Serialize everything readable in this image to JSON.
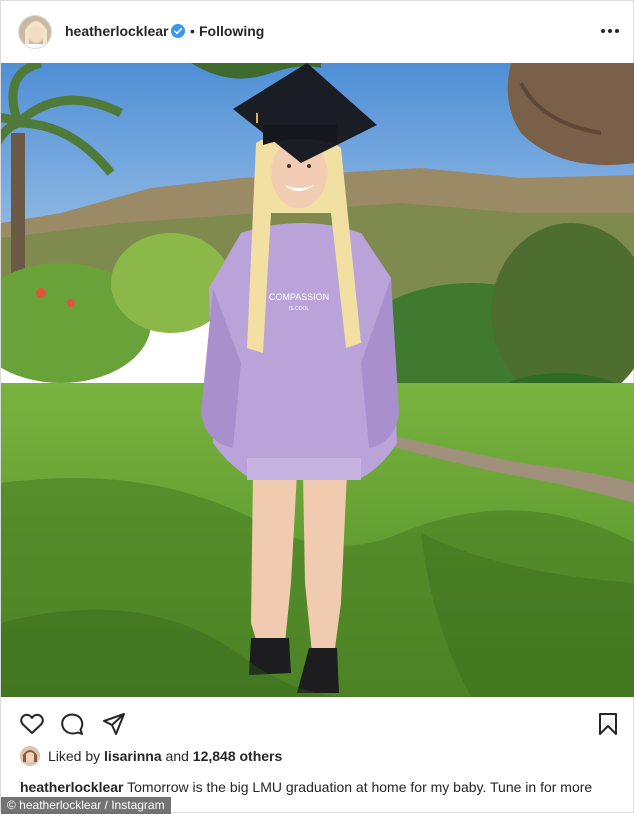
{
  "header": {
    "username": "heatherlocklear",
    "separator": "•",
    "follow_state": "Following",
    "icons": {
      "verified": "verified-badge-icon",
      "more": "more-options-icon"
    }
  },
  "photo": {
    "alt": "Graduate in a lavender sweatshirt and black mortarboard standing on a lawn",
    "sweatshirt_text": "COMPASSION",
    "sweatshirt_subtext": "IS COOL"
  },
  "actions": {
    "icons": [
      "heart-icon",
      "comment-icon",
      "share-icon",
      "bookmark-icon"
    ]
  },
  "likes": {
    "prefix": "Liked by",
    "user": "lisarinna",
    "middle": "and",
    "count": "12,848 others"
  },
  "caption": {
    "username": "heatherlocklear",
    "text": "Tomorrow is the big LMU graduation at home for my baby. Tune in for more"
  },
  "credit": "© heatherlocklear / Instagram",
  "colors": {
    "verified": "#3897f0",
    "text": "#262626",
    "sky": "#5b9bd5",
    "grass": "#5f9b2f",
    "sweatshirt": "#b9a3d9"
  }
}
